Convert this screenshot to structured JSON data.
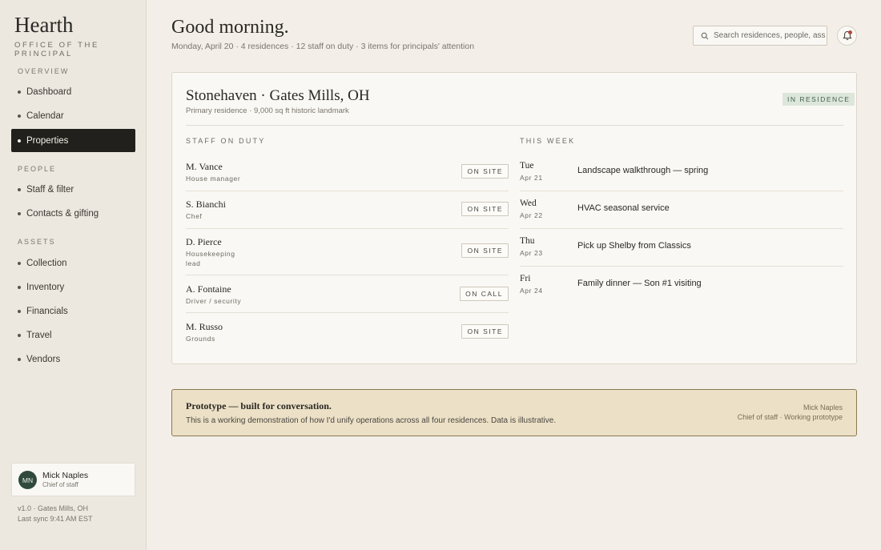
{
  "sidebar": {
    "brand": "Hearth",
    "brand_sub": "OFFICE OF THE PRINCIPAL",
    "sections": [
      {
        "label": "OVERVIEW",
        "items": [
          {
            "label": "Dashboard",
            "active": false
          },
          {
            "label": "Calendar",
            "active": false
          },
          {
            "label": "Properties",
            "active": true
          }
        ]
      },
      {
        "label": "PEOPLE",
        "items": [
          {
            "label": "Staff & filter",
            "active": false
          },
          {
            "label": "Contacts & gifting",
            "active": false
          }
        ]
      },
      {
        "label": "ASSETS",
        "items": [
          {
            "label": "Collection",
            "active": false
          },
          {
            "label": "Inventory",
            "active": false
          },
          {
            "label": "Financials",
            "active": false
          },
          {
            "label": "Travel",
            "active": false
          },
          {
            "label": "Vendors",
            "active": false
          }
        ]
      }
    ],
    "user": {
      "initials": "MN",
      "name": "Mick Naples",
      "role": "Chief of staff"
    },
    "version": "v1.0 · Gates Mills, OH",
    "sync": "Last sync 9:41 AM EST"
  },
  "header": {
    "greeting": "Good morning.",
    "subline": "Monday, April 20 · 4 residences · 12 staff on duty · 3 items for principals' attention",
    "search_placeholder": "Search residences, people, assets",
    "search_icon": "search-icon",
    "bell_icon": "bell-icon"
  },
  "property": {
    "title": "Stonehaven · Gates Mills, OH",
    "subtitle": "Primary residence · 9,000 sq ft historic landmark",
    "status": "IN RESIDENCE",
    "status_color": "#dde6da",
    "staff_label": "STAFF ON DUTY",
    "staff": [
      {
        "name": "M. Vance",
        "role": "House manager",
        "status": "ON SITE"
      },
      {
        "name": "S. Bianchi",
        "role": "Chef",
        "status": "ON SITE"
      },
      {
        "name": "D. Pierce",
        "role": "Housekeeping lead",
        "status": "ON SITE"
      },
      {
        "name": "A. Fontaine",
        "role": "Driver / security",
        "status": "ON CALL"
      },
      {
        "name": "M. Russo",
        "role": "Grounds",
        "status": "ON SITE"
      }
    ],
    "week_label": "THIS WEEK",
    "week": [
      {
        "day": "Tue",
        "date": "Apr 21",
        "event": "Landscape walkthrough — spring"
      },
      {
        "day": "Wed",
        "date": "Apr 22",
        "event": "HVAC seasonal service"
      },
      {
        "day": "Thu",
        "date": "Apr 23",
        "event": "Pick up Shelby from Classics"
      },
      {
        "day": "Fri",
        "date": "Apr 24",
        "event": "Family dinner — Son #1 visiting"
      }
    ]
  },
  "notice": {
    "title": "Prototype — built for conversation.",
    "body": "This is a working demonstration of how I'd unify operations across all four residences. Data is illustrative.",
    "signature_name": "Mick Naples",
    "signature_role": "Chief of staff · Working prototype",
    "background": "#ece0c6"
  }
}
